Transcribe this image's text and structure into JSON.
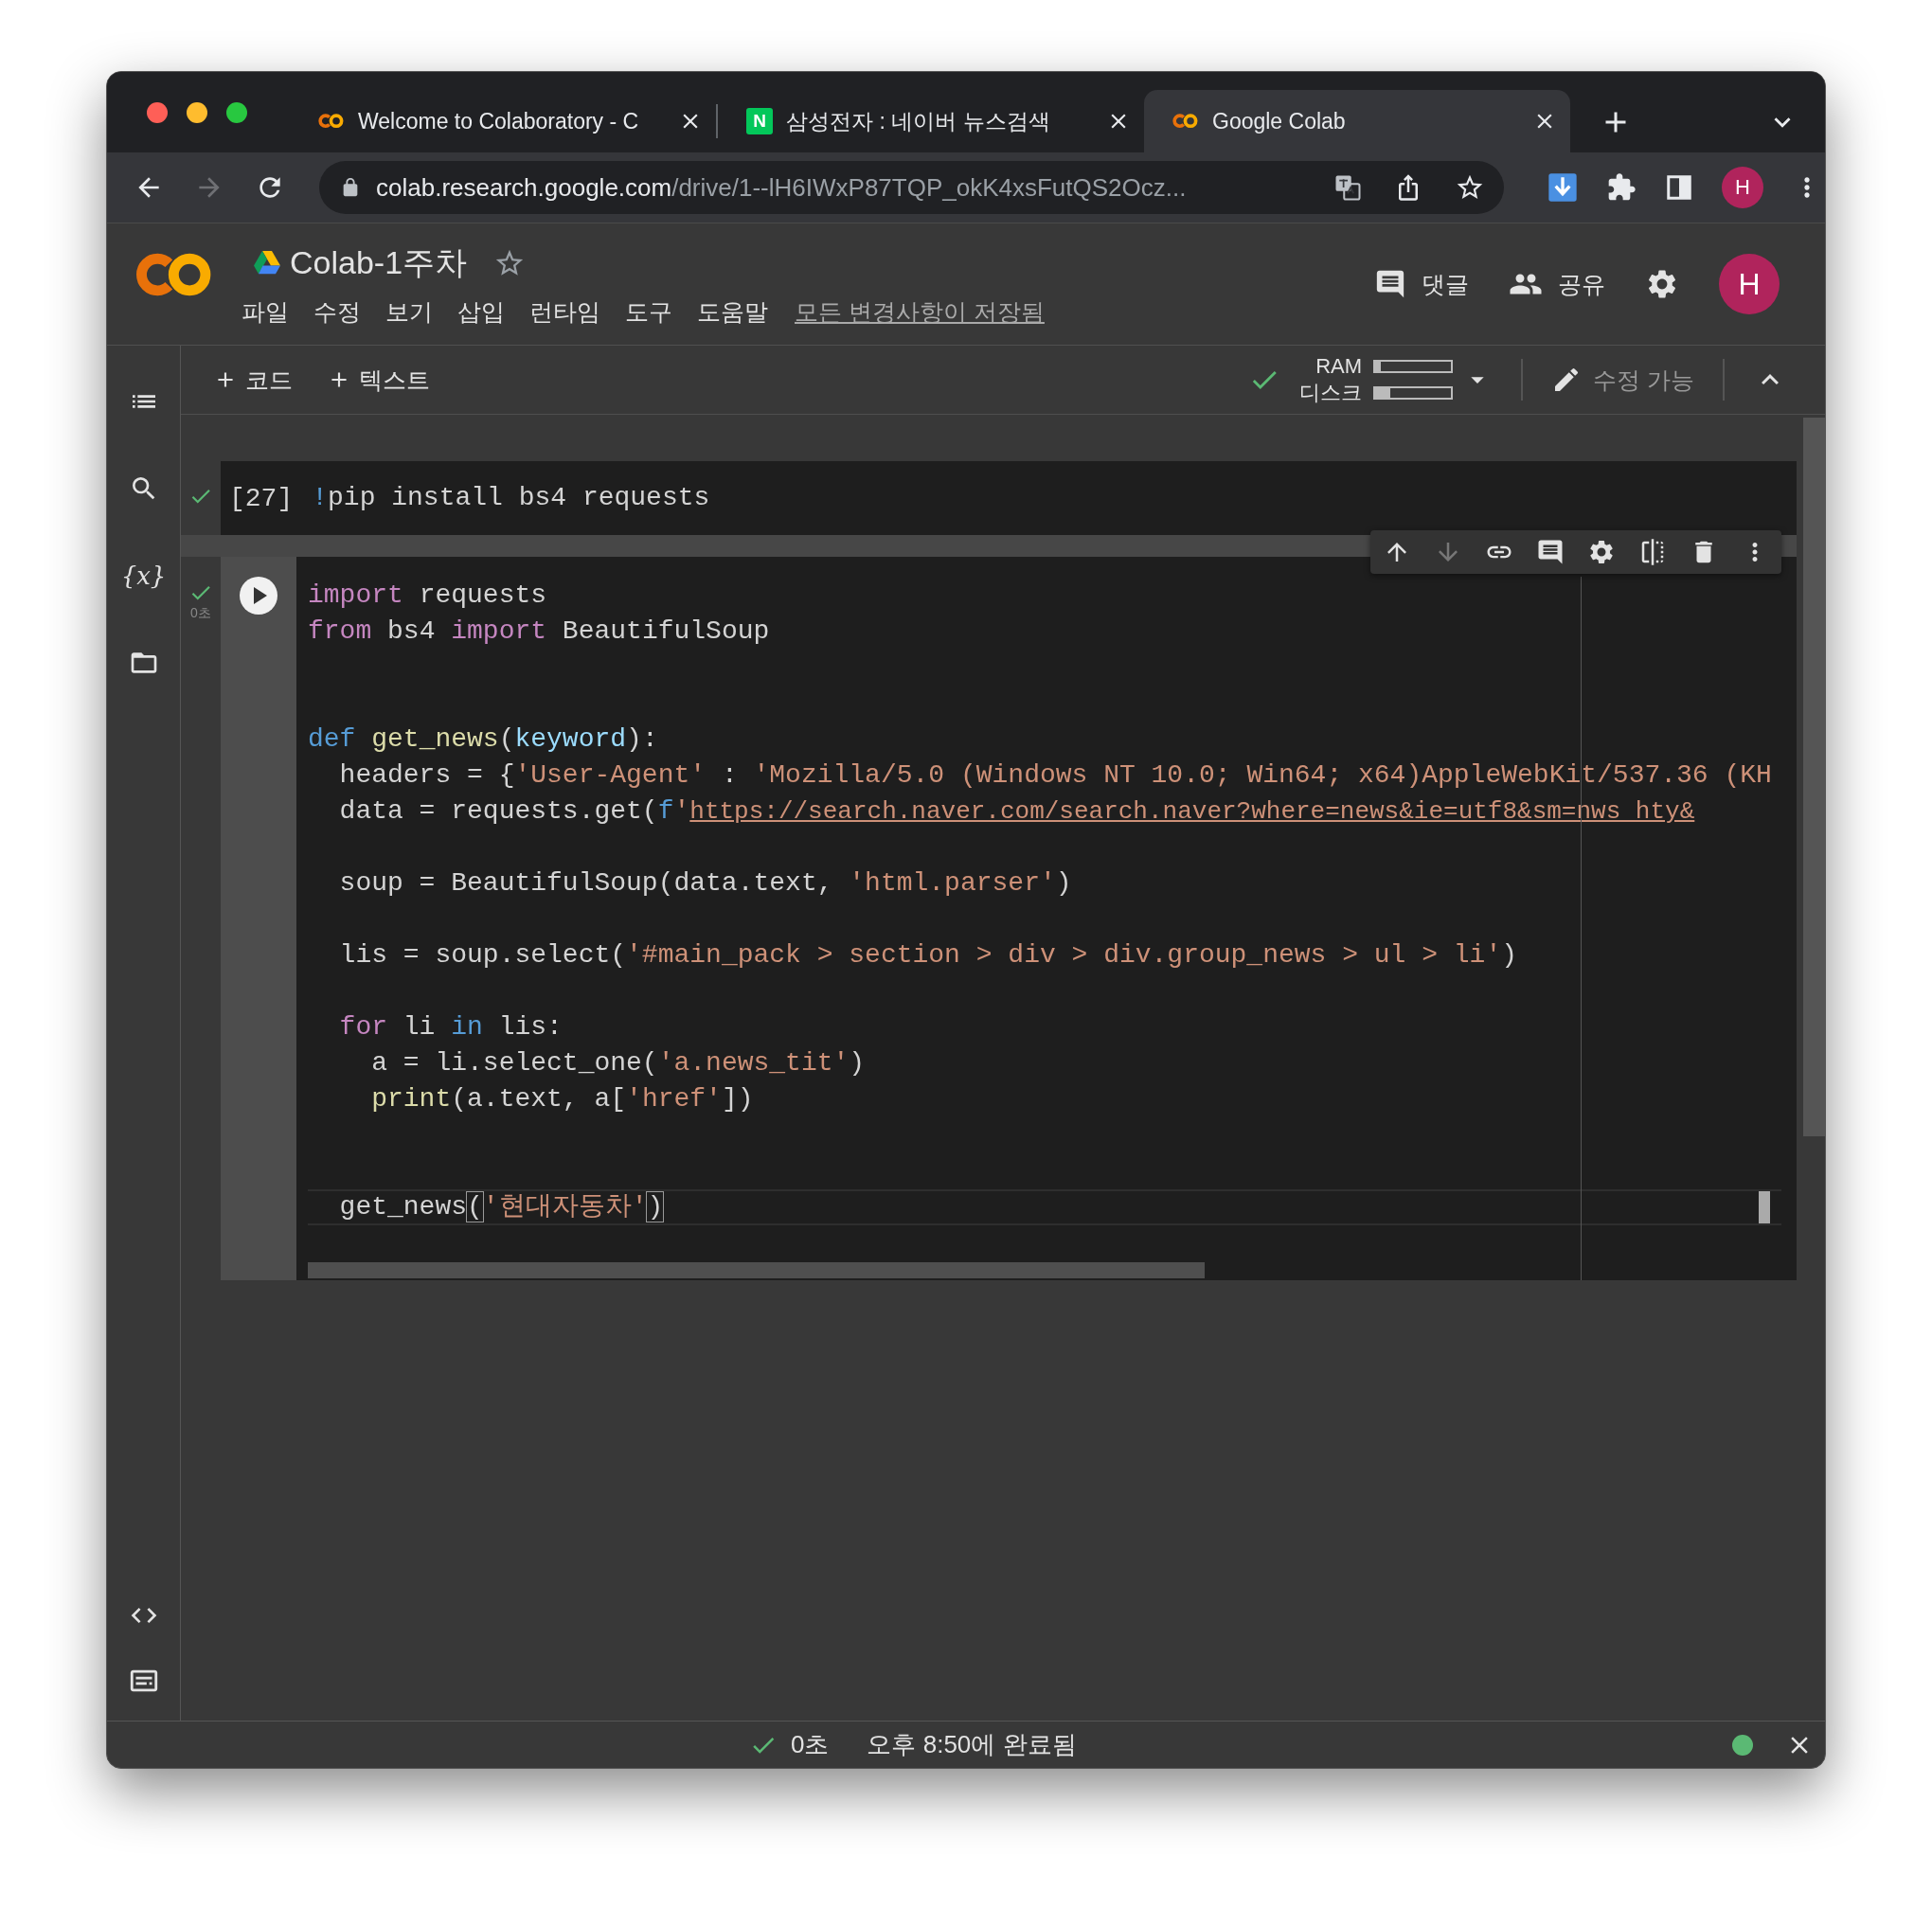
{
  "browser": {
    "tabs": [
      {
        "title": "Welcome to Colaboratory - C",
        "kind": "colab",
        "selected": false
      },
      {
        "title": "삼성전자 : 네이버 뉴스검색",
        "kind": "letter",
        "favicon_label": "N",
        "selected": false
      },
      {
        "title": "Google Colab",
        "kind": "colab",
        "selected": true
      }
    ],
    "forward_disabled": true,
    "address": {
      "host": "colab.research.google.com",
      "path": "/drive/1--lH6IWxP87TQP_okK4xsFutQS2Ocz..."
    },
    "profile_initial": "H"
  },
  "notebook": {
    "title": "Colab-1주차",
    "starred": false,
    "menu": [
      "파일",
      "수정",
      "보기",
      "삽입",
      "런타임",
      "도구",
      "도움말"
    ],
    "save_status": "모든 변경사항이 저장됨",
    "comment_label": "댓글",
    "share_label": "공유",
    "avatar_initial": "H"
  },
  "toolbar": {
    "add_code": "코드",
    "add_text": "텍스트",
    "connected": true,
    "ram": {
      "label": "RAM",
      "level": 0.08
    },
    "disk": {
      "label": "디스크",
      "level": 0.2
    },
    "edit_mode": "수정 가능"
  },
  "sidebar": {
    "variables_glyph": "{x}"
  },
  "cells": [
    {
      "selected": false,
      "executed": true,
      "prompt": "[27]",
      "lines": [
        {
          "kind": "code",
          "tokens": [
            {
              "t": "!",
              "kind": "blue"
            },
            {
              "t": "pip install bs4 requests",
              "kind": "plain"
            }
          ]
        }
      ]
    },
    {
      "selected": true,
      "executed": true,
      "run_time": "0초",
      "move_down_disabled": true,
      "lines": [
        {
          "kind": "code",
          "tokens": [
            {
              "t": "import",
              "kind": "kw"
            },
            {
              "t": " requests",
              "kind": "plain"
            }
          ]
        },
        {
          "kind": "code",
          "tokens": [
            {
              "t": "from",
              "kind": "kw"
            },
            {
              "t": " bs4 ",
              "kind": "plain"
            },
            {
              "t": "import",
              "kind": "kw"
            },
            {
              "t": " BeautifulSoup",
              "kind": "plain"
            }
          ]
        },
        {
          "kind": "blank"
        },
        {
          "kind": "blank"
        },
        {
          "kind": "code",
          "tokens": [
            {
              "t": "def ",
              "kind": "blue"
            },
            {
              "t": "get_news",
              "kind": "fn"
            },
            {
              "t": "(",
              "kind": "plain"
            },
            {
              "t": "keyword",
              "kind": "param"
            },
            {
              "t": "):",
              "kind": "plain"
            }
          ]
        },
        {
          "kind": "code",
          "tokens": [
            {
              "t": "  headers = {",
              "kind": "plain"
            },
            {
              "t": "'User-Agent'",
              "kind": "str"
            },
            {
              "t": " : ",
              "kind": "plain"
            },
            {
              "t": "'Mozilla/5.0 (Windows NT 10.0; Win64; x64)AppleWebKit/537.36 (KH",
              "kind": "str"
            }
          ]
        },
        {
          "kind": "code",
          "tokens": [
            {
              "t": "  data = requests.get(",
              "kind": "plain"
            },
            {
              "t": "f",
              "kind": "blue"
            },
            {
              "t": "'",
              "kind": "str"
            },
            {
              "t": "https://search.naver.com/search.naver?where=news&ie=utf8&sm=nws_hty&",
              "kind": "url"
            }
          ]
        },
        {
          "kind": "blank"
        },
        {
          "kind": "code",
          "tokens": [
            {
              "t": "  soup = BeautifulSoup(data.text, ",
              "kind": "plain"
            },
            {
              "t": "'html.parser'",
              "kind": "str"
            },
            {
              "t": ")",
              "kind": "plain"
            }
          ]
        },
        {
          "kind": "blank"
        },
        {
          "kind": "code",
          "tokens": [
            {
              "t": "  lis = soup.select(",
              "kind": "plain"
            },
            {
              "t": "'#main_pack > section > div > div.group_news > ul > li'",
              "kind": "str"
            },
            {
              "t": ")",
              "kind": "plain"
            }
          ]
        },
        {
          "kind": "blank"
        },
        {
          "kind": "code",
          "tokens": [
            {
              "t": "  for",
              "kind": "kw"
            },
            {
              "t": " li ",
              "kind": "plain"
            },
            {
              "t": "in",
              "kind": "blue"
            },
            {
              "t": " lis:",
              "kind": "plain"
            }
          ]
        },
        {
          "kind": "code",
          "tokens": [
            {
              "t": "    a = li.select_one(",
              "kind": "plain"
            },
            {
              "t": "'a.news_tit'",
              "kind": "str"
            },
            {
              "t": ")",
              "kind": "plain"
            }
          ]
        },
        {
          "kind": "code",
          "tokens": [
            {
              "t": "    print",
              "kind": "fn"
            },
            {
              "t": "(a.text, a[",
              "kind": "plain"
            },
            {
              "t": "'href'",
              "kind": "str"
            },
            {
              "t": "])",
              "kind": "plain"
            }
          ]
        },
        {
          "kind": "blank"
        },
        {
          "kind": "blank"
        },
        {
          "kind": "current",
          "tokens": [
            {
              "t": "  get_news",
              "kind": "plain"
            },
            {
              "t": "(",
              "kind": "match"
            },
            {
              "t": "'현대자동차'",
              "kind": "str"
            },
            {
              "t": ")",
              "kind": "match"
            }
          ]
        }
      ]
    }
  ],
  "status_bar": {
    "ok": true,
    "duration": "0초",
    "message": "오후 8:50에 완료됨",
    "connected": true
  }
}
